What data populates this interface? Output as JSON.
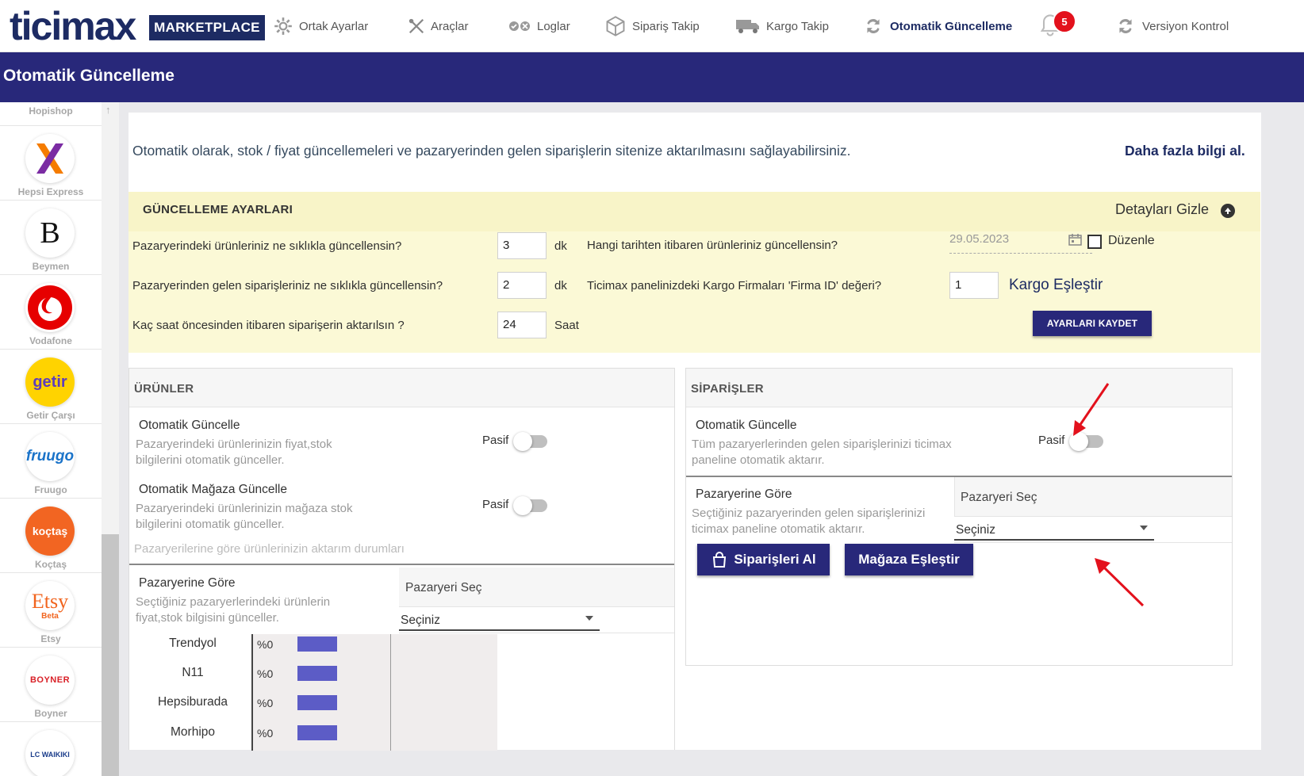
{
  "brand": {
    "logo_word": "ticimax",
    "logo_badge": "MARKETPLACE"
  },
  "nav": {
    "common_settings": "Ortak Ayarlar",
    "tools": "Araçlar",
    "logs": "Loglar",
    "order_tracking": "Sipariş Takip",
    "cargo_tracking": "Kargo Takip",
    "auto_update": "Otomatik Güncelleme",
    "notification_count": "5",
    "version_control": "Versiyon Kontrol"
  },
  "header": {
    "title": "Otomatik Güncelleme"
  },
  "sidebar": {
    "items": [
      {
        "name": "Hopishop"
      },
      {
        "name": "Hepsi Express"
      },
      {
        "name": "Beymen",
        "logo_text": "B"
      },
      {
        "name": "Vodafone"
      },
      {
        "name": "Getir Çarşı",
        "logo_text": "getir"
      },
      {
        "name": "Fruugo",
        "logo_text": "fruugo"
      },
      {
        "name": "Koçtaş",
        "logo_text": "koçtaş"
      },
      {
        "name": "Etsy",
        "logo_text": "Etsy",
        "logo_sub": "Beta"
      },
      {
        "name": "Boyner",
        "logo_text": "BOYNER"
      },
      {
        "name": "",
        "logo_text": "LC WAIKIKI"
      }
    ]
  },
  "intro": {
    "text": "Otomatik olarak, stok / fiyat güncellemeleri ve pazaryerinden gelen siparişlerin sitenize aktarılmasını sağlayabilirsiniz.",
    "more_link": "Daha fazla bilgi al."
  },
  "settings": {
    "title": "GÜNCELLEME AYARLARI",
    "hide_details": "Detayları Gizle",
    "q1": "Pazaryerindeki ürünleriniz ne sıklıkla güncellensin?",
    "q1_value": "3",
    "q1_unit": "dk",
    "q2": "Pazaryerinden gelen siparişleriniz ne sıklıkla güncellensin?",
    "q2_value": "2",
    "q2_unit": "dk",
    "q3": "Kaç saat öncesinden itibaren siparişerin aktarılsın ?",
    "q3_value": "24",
    "q3_unit": "Saat",
    "q4": "Hangi tarihten itibaren ürünleriniz güncellensin?",
    "date_value": "29.05.2023",
    "edit_label": "Düzenle",
    "q5": "Ticimax panelinizdeki Kargo Firmaları 'Firma ID' değeri?",
    "firm_id_value": "1",
    "cargo_match": "Kargo Eşleştir",
    "save_button": "AYARLARI KAYDET"
  },
  "products": {
    "title": "ÜRÜNLER",
    "auto_update_title": "Otomatik Güncelle",
    "auto_update_desc": "Pazaryerindeki ürünlerinizin fiyat,stok bilgilerini otomatik günceller.",
    "auto_update_state": "Pasif",
    "store_update_title": "Otomatik Mağaza Güncelle",
    "store_update_desc": "Pazaryerindeki ürünlerinizin mağaza stok bilgilerini otomatik günceller.",
    "store_update_state": "Pasif",
    "transfer_status": "Pazaryerilerine göre ürünlerinizin aktarım durumları",
    "by_marketplace_title": "Pazaryerine Göre",
    "by_marketplace_desc": "Seçtiğiniz pazaryerlerindeki ürünlerin fiyat,stok bilgisini günceller.",
    "select_head": "Pazaryeri Seç",
    "select_value": "Seçiniz",
    "marketplaces": [
      {
        "name": "Trendyol",
        "percent": "%0"
      },
      {
        "name": "N11",
        "percent": "%0"
      },
      {
        "name": "Hepsiburada",
        "percent": "%0"
      },
      {
        "name": "Morhipo",
        "percent": "%0"
      }
    ]
  },
  "orders": {
    "title": "SİPARİŞLER",
    "auto_update_title": "Otomatik Güncelle",
    "auto_update_desc": "Tüm pazaryerlerinden gelen siparişlerinizi ticimax paneline otomatik aktarır.",
    "auto_update_state": "Pasif",
    "by_marketplace_title": "Pazaryerine Göre",
    "by_marketplace_desc": "Seçtiğiniz pazaryerinden gelen siparişlerinizi ticimax paneline otomatik aktarır.",
    "select_head": "Pazaryeri Seç",
    "select_value": "Seçiniz",
    "get_orders_button": "Siparişleri Al",
    "store_match_button": "Mağaza Eşleştir"
  },
  "colors": {
    "brand_navy": "#28287a",
    "annotation_red": "#e3111c",
    "bar": "#5c5cc6"
  }
}
